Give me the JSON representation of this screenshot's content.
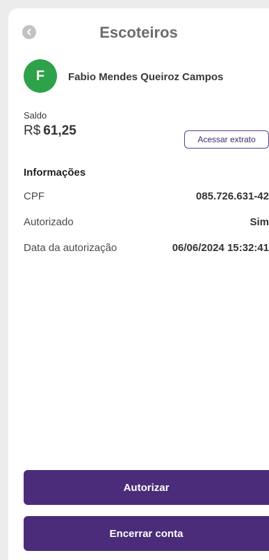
{
  "header": {
    "title": "Escoteiros",
    "back_icon": "chevron-left-icon"
  },
  "user": {
    "avatar_initial": "F",
    "avatar_color": "#2ea24a",
    "name": "Fabio Mendes Queiroz Campos"
  },
  "balance": {
    "label": "Saldo",
    "currency": "R$",
    "amount": "61,25",
    "statement_button": "Acessar extrato"
  },
  "info": {
    "title": "Informações",
    "rows": [
      {
        "label": "CPF",
        "value": "085.726.631-42"
      },
      {
        "label": "Autorizado",
        "value": "Sim"
      },
      {
        "label": "Data da autorização",
        "value": "06/06/2024 15:32:41"
      }
    ]
  },
  "actions": {
    "authorize_label": "Autorizar",
    "close_account_label": "Encerrar conta",
    "accent_color": "#4a2c7a"
  }
}
